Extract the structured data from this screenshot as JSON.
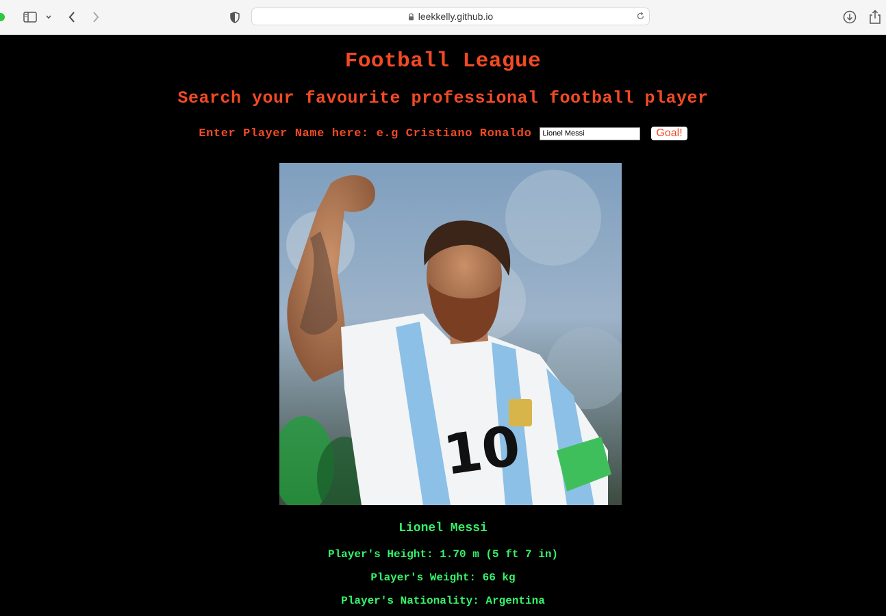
{
  "browser": {
    "url": "leekkelly.github.io"
  },
  "page": {
    "title": "Football League",
    "subtitle": "Search your favourite professional football player",
    "search_label": "Enter Player Name here: e.g Cristiano Ronaldo",
    "search_value": "Lionel Messi",
    "search_button": "Goal!"
  },
  "player": {
    "photo_icon": "player-photo",
    "name": "Lionel Messi",
    "height": "Player's Height: 1.70 m (5 ft 7 in)",
    "weight": "Player's Weight: 66 kg",
    "nationality": "Player's Nationality: Argentina",
    "shirt_number": "10"
  },
  "colors": {
    "heading": "#f24a24",
    "player_text": "#36f36a",
    "background": "#000000"
  }
}
